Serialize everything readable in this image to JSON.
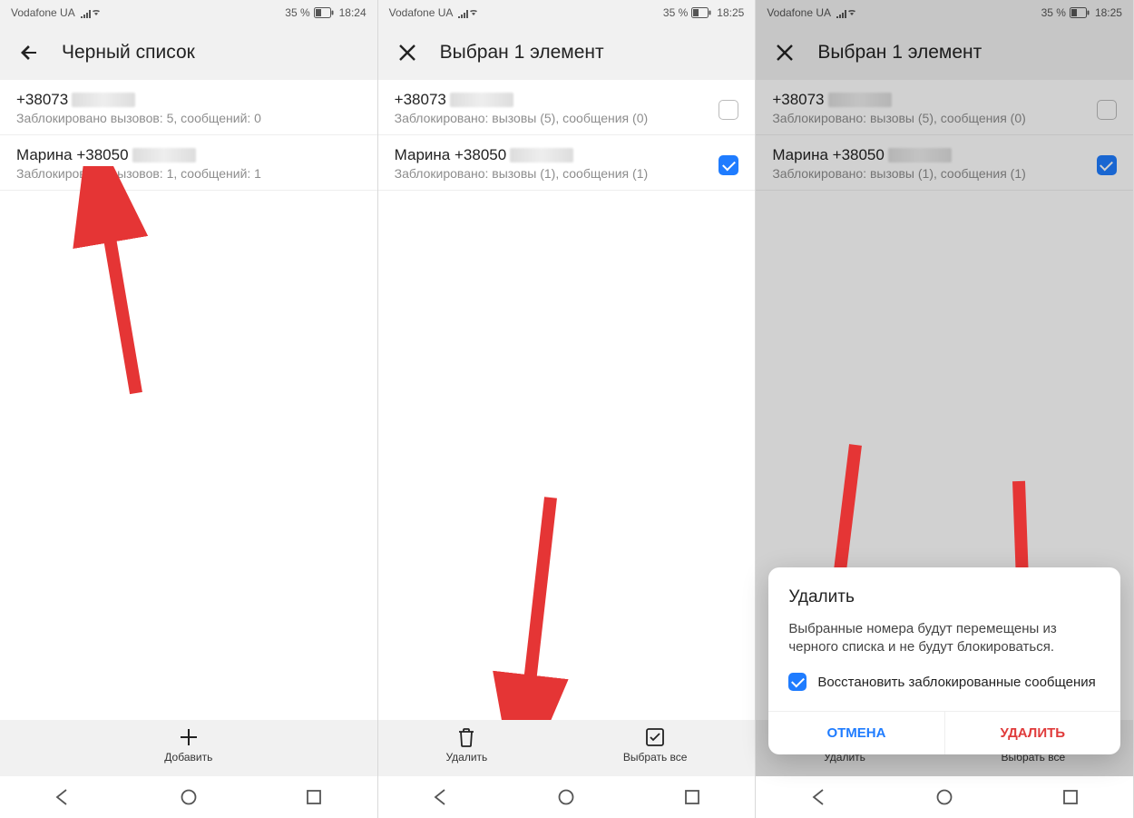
{
  "status": {
    "carrier": "Vodafone UA",
    "battery_pct": "35 %",
    "time1": "18:24",
    "time2": "18:25",
    "time3": "18:25"
  },
  "screens": [
    {
      "title": "Черный список",
      "items": [
        {
          "title_prefix": "+38073",
          "subtitle": "Заблокировано вызовов: 5, сообщений: 0"
        },
        {
          "title_prefix": "Марина +38050",
          "subtitle": "Заблокировано вызовов: 1, сообщений: 1"
        }
      ],
      "bottom_action": "Добавить"
    },
    {
      "title": "Выбран 1 элемент",
      "items": [
        {
          "title_prefix": "+38073",
          "subtitle": "Заблокировано: вызовы (5), сообщения (0)",
          "checked": false
        },
        {
          "title_prefix": "Марина +38050",
          "subtitle": "Заблокировано: вызовы (1), сообщения (1)",
          "checked": true
        }
      ],
      "bottom_actions": [
        "Удалить",
        "Выбрать все"
      ]
    },
    {
      "title": "Выбран 1 элемент",
      "items": [
        {
          "title_prefix": "+38073",
          "subtitle": "Заблокировано: вызовы (5), сообщения (0)",
          "checked": false
        },
        {
          "title_prefix": "Марина +38050",
          "subtitle": "Заблокировано: вызовы (1), сообщения (1)",
          "checked": true
        }
      ],
      "bottom_actions": [
        "Удалить",
        "Выбрать все"
      ],
      "dialog": {
        "title": "Удалить",
        "message": "Выбранные номера будут перемещены из черного списка и не будут блокироваться.",
        "checkbox_label": "Восстановить заблокированные сообщения",
        "cancel": "ОТМЕНА",
        "confirm": "УДАЛИТЬ"
      }
    }
  ]
}
